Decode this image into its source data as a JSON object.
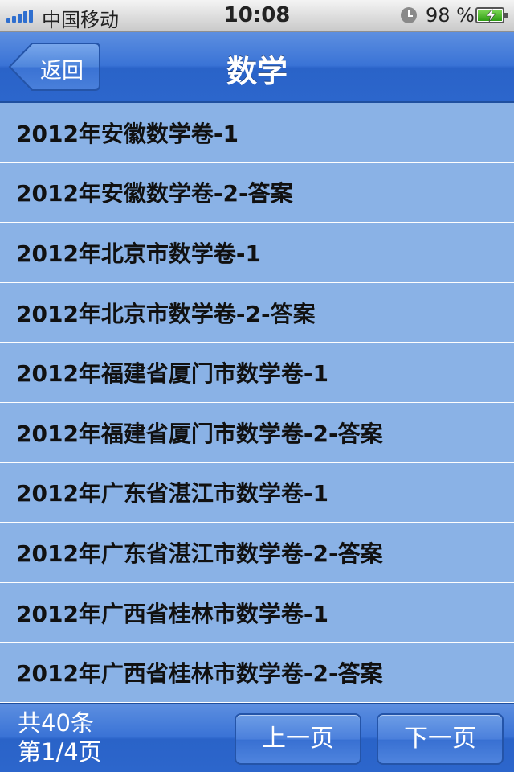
{
  "status_bar": {
    "carrier": "中国移动",
    "time": "10:08",
    "battery": "98 %"
  },
  "nav": {
    "back_label": "返回",
    "title": "数学"
  },
  "list": {
    "items": [
      "2012年安徽数学卷-1",
      "2012年安徽数学卷-2-答案",
      "2012年北京市数学卷-1",
      "2012年北京市数学卷-2-答案",
      "2012年福建省厦门市数学卷-1",
      "2012年福建省厦门市数学卷-2-答案",
      "2012年广东省湛江市数学卷-1",
      "2012年广东省湛江市数学卷-2-答案",
      "2012年广西省桂林市数学卷-1",
      "2012年广西省桂林市数学卷-2-答案"
    ]
  },
  "footer": {
    "total": "共40条",
    "page": "第1/4页",
    "prev_label": "上一页",
    "next_label": "下一页"
  }
}
